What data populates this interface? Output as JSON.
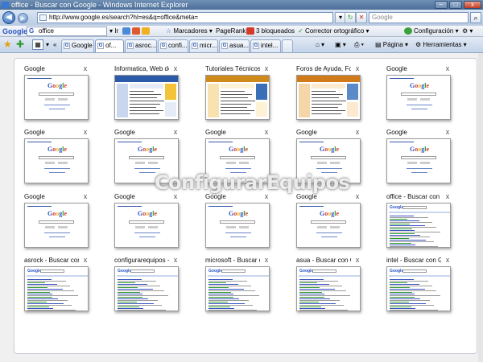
{
  "window": {
    "title": "office - Buscar con Google - Windows Internet Explorer",
    "minimize": "–",
    "maximize": "□",
    "close": "x"
  },
  "address": {
    "url": "http://www.google.es/search?hl=es&q=office&meta=",
    "search_placeholder": "Google"
  },
  "google_toolbar": {
    "logo": "Google",
    "query": "office",
    "bookmarks": "Marcadores",
    "pagerank": "PageRank",
    "blocked": "3 bloqueados",
    "spell": "Corrector ortográfico",
    "settings": "Configuración"
  },
  "tabs": [
    {
      "label": "Google"
    },
    {
      "label": "of..."
    },
    {
      "label": "asroc..."
    },
    {
      "label": "confi..."
    },
    {
      "label": "micr..."
    },
    {
      "label": "asua..."
    },
    {
      "label": "intel..."
    }
  ],
  "commands": {
    "page": "Página",
    "tools": "Herramientas"
  },
  "thumbnails": [
    {
      "title": "Google",
      "kind": "google"
    },
    {
      "title": "Informatica, Web de...",
      "kind": "site1"
    },
    {
      "title": "Tutoriales Técnicos,...",
      "kind": "site2"
    },
    {
      "title": "Foros de Ayuda, For...",
      "kind": "site3"
    },
    {
      "title": "Google",
      "kind": "google"
    },
    {
      "title": "Google",
      "kind": "google"
    },
    {
      "title": "Google",
      "kind": "google"
    },
    {
      "title": "Google",
      "kind": "google"
    },
    {
      "title": "Google",
      "kind": "google"
    },
    {
      "title": "Google",
      "kind": "google"
    },
    {
      "title": "Google",
      "kind": "google"
    },
    {
      "title": "Google",
      "kind": "google"
    },
    {
      "title": "Google",
      "kind": "google"
    },
    {
      "title": "Google",
      "kind": "google"
    },
    {
      "title": "office - Buscar con ...",
      "kind": "results"
    },
    {
      "title": "asrock - Buscar con ...",
      "kind": "results"
    },
    {
      "title": "configurarequipos -...",
      "kind": "results"
    },
    {
      "title": "microsoft - Buscar c...",
      "kind": "results"
    },
    {
      "title": "asua - Buscar con G...",
      "kind": "results"
    },
    {
      "title": "intel - Buscar con G...",
      "kind": "results"
    }
  ],
  "thumb_close": "x",
  "watermark": "ConfigurarEquipos",
  "colors": {
    "accent": "#4c6f98",
    "google_blue": "#2a54c4"
  }
}
